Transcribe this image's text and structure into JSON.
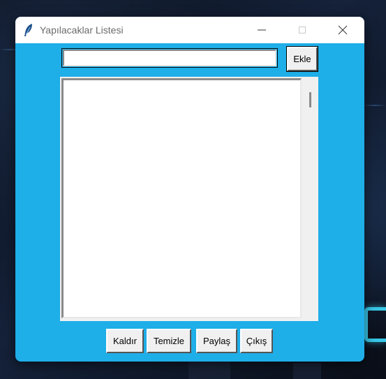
{
  "window": {
    "title": "Yapılacaklar Listesi",
    "background_color": "#1eaee8"
  },
  "controls": {
    "minimize_icon": "minimize-icon",
    "maximize_icon": "maximize-icon",
    "close_icon": "close-icon"
  },
  "entry": {
    "value": "",
    "placeholder": ""
  },
  "buttons": {
    "add": "Ekle",
    "remove": "Kaldır",
    "clear": "Temizle",
    "share": "Paylaş",
    "exit": "Çıkış"
  },
  "task_list": {
    "items": []
  }
}
